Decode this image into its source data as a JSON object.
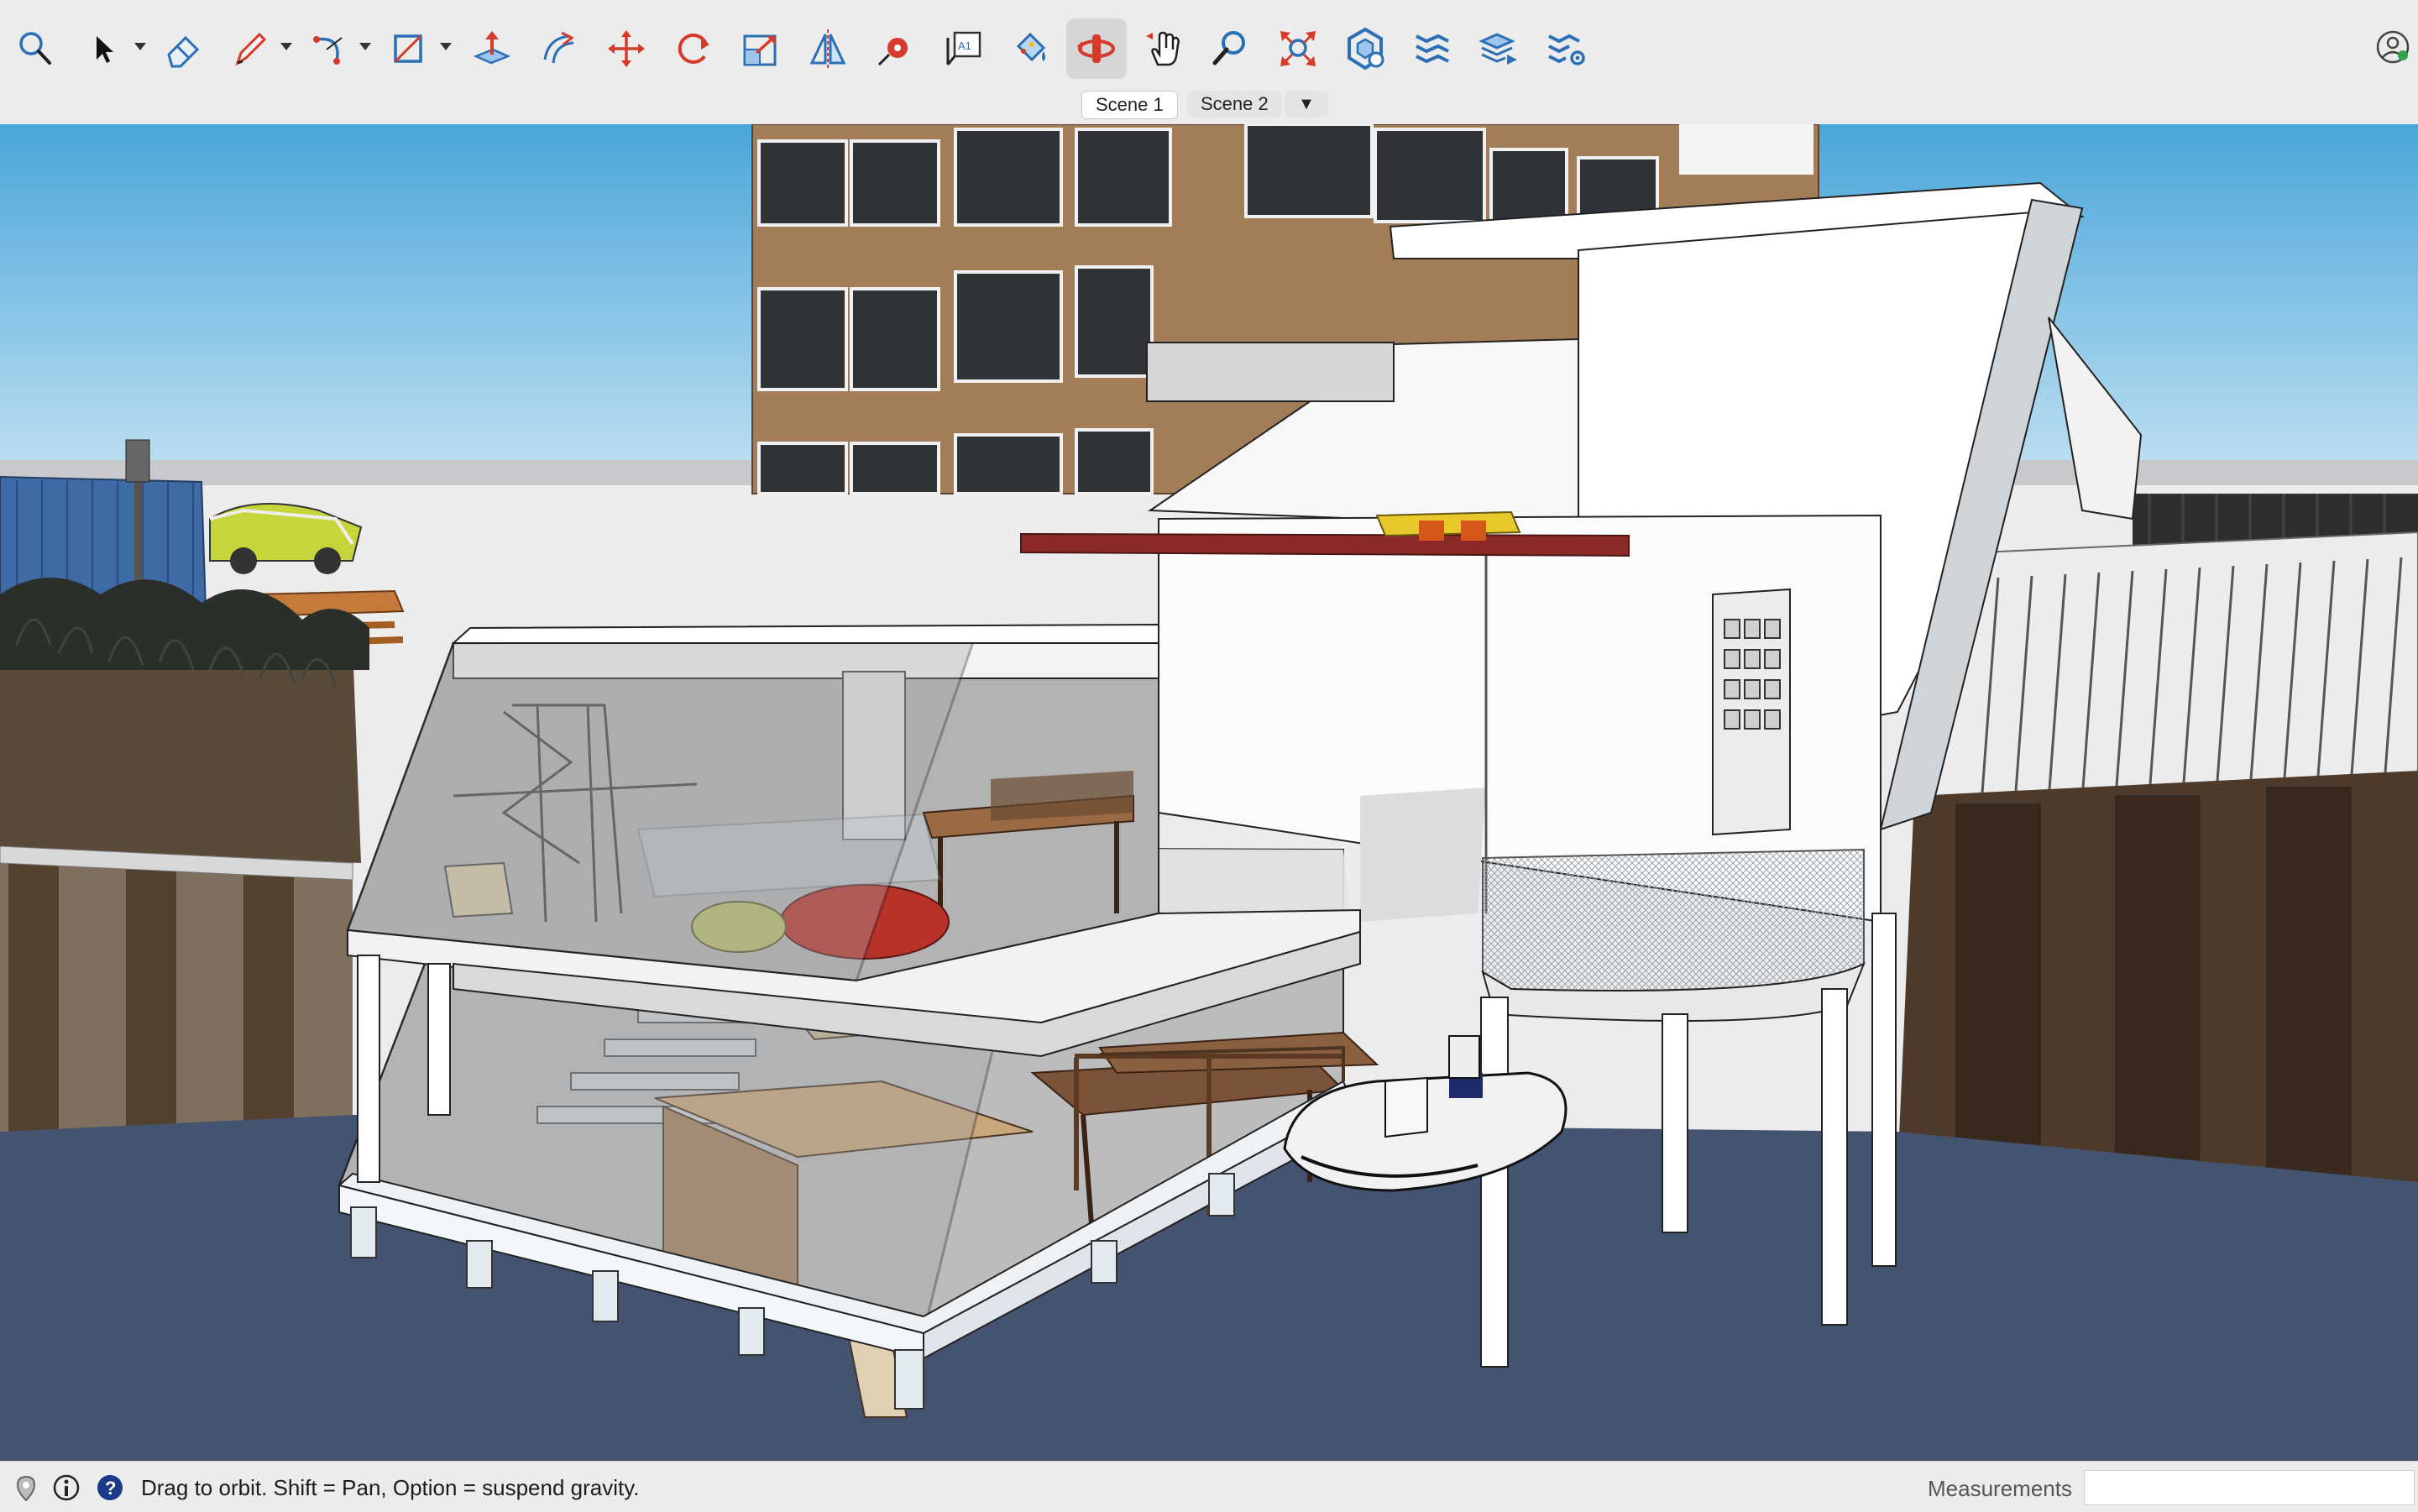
{
  "toolbar": {
    "tools": [
      {
        "name": "search-tool",
        "icon": "search-icon"
      },
      {
        "name": "select-tool",
        "icon": "arrow-icon",
        "has_menu": true
      },
      {
        "name": "eraser-tool",
        "icon": "eraser-icon"
      },
      {
        "name": "line-tool",
        "icon": "pencil-icon",
        "has_menu": true
      },
      {
        "name": "arc-tool",
        "icon": "arc-icon",
        "has_menu": true
      },
      {
        "name": "rectangle-tool",
        "icon": "rectangle-icon",
        "has_menu": true
      },
      {
        "name": "push-pull-tool",
        "icon": "push-pull-icon"
      },
      {
        "name": "offset-tool",
        "icon": "offset-icon"
      },
      {
        "name": "move-tool",
        "icon": "move-icon"
      },
      {
        "name": "rotate-tool",
        "icon": "rotate-icon"
      },
      {
        "name": "scale-tool",
        "icon": "scale-icon"
      },
      {
        "name": "flip-tool",
        "icon": "flip-icon"
      },
      {
        "name": "tape-measure-tool",
        "icon": "tape-measure-icon"
      },
      {
        "name": "text-tool",
        "icon": "text-icon",
        "glyph": "A1"
      },
      {
        "name": "paint-bucket-tool",
        "icon": "paint-bucket-icon"
      },
      {
        "name": "orbit-tool",
        "icon": "orbit-icon",
        "active": true
      },
      {
        "name": "pan-tool",
        "icon": "pan-hand-icon"
      },
      {
        "name": "zoom-tool",
        "icon": "zoom-icon"
      },
      {
        "name": "zoom-extents-tool",
        "icon": "zoom-extents-icon"
      },
      {
        "name": "components-panel",
        "icon": "components-icon"
      },
      {
        "name": "tags-panel",
        "icon": "tags-icon"
      },
      {
        "name": "scenes-panel",
        "icon": "scenes-icon"
      },
      {
        "name": "styles-panel",
        "icon": "styles-settings-icon"
      }
    ],
    "account_icon": "account-icon"
  },
  "scenes": {
    "tabs": [
      "Scene 1",
      "Scene 2"
    ],
    "active": "Scene 1",
    "menu_glyph": "▼"
  },
  "viewport": {
    "content": "3D model of a two-storey glass-fronted waterfront building sectioned to show interior",
    "colors": {
      "sky": "#5fb0dc",
      "water": "#44536f",
      "facade": "#a27d58",
      "beam": "#8b2a26"
    }
  },
  "statusbar": {
    "icons": [
      "geo-location-icon",
      "credit-icon",
      "help-icon"
    ],
    "message": "Drag to orbit. Shift = Pan, Option = suspend gravity.",
    "measurements_label": "Measurements",
    "measurements_value": ""
  }
}
